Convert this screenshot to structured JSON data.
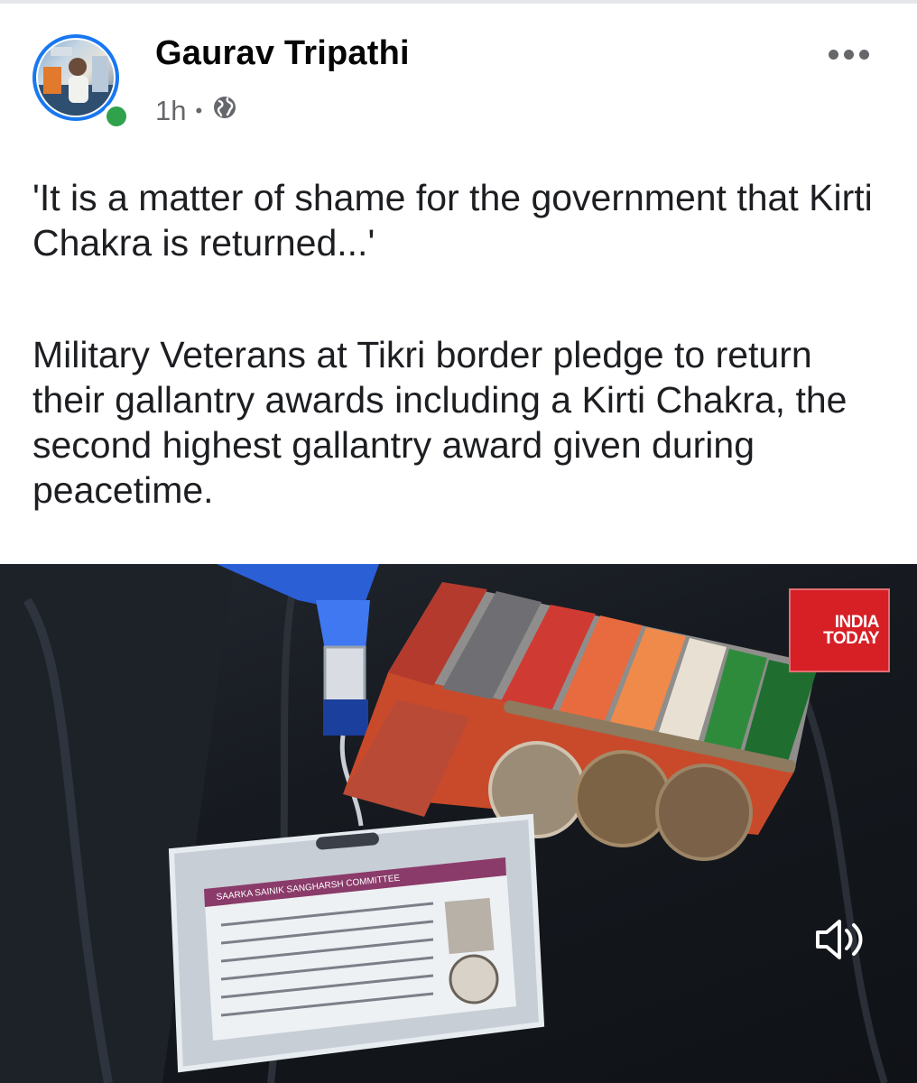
{
  "post": {
    "author": "Gaurav Tripathi",
    "time": "1h",
    "separator": "•",
    "audience_icon": "globe-icon",
    "more_icon": "more-options-icon",
    "paragraphs": [
      "'It is a matter of shame for the government that Kirti Chakra is returned...'",
      "Military Veterans at Tikri border pledge to return their gallantry awards including a Kirti Chakra, the second highest gallantry award given during peacetime."
    ]
  },
  "media": {
    "brand_line1": "INDIA",
    "brand_line2": "TODAY",
    "sound_icon": "speaker-icon",
    "id_card_text": "SAARKA SAINIK SANGHARSH COMMITTEE"
  },
  "colors": {
    "accent": "#1877f2",
    "online": "#31a24c",
    "brand_red": "#d71f26",
    "meta_gray": "#65676b"
  }
}
